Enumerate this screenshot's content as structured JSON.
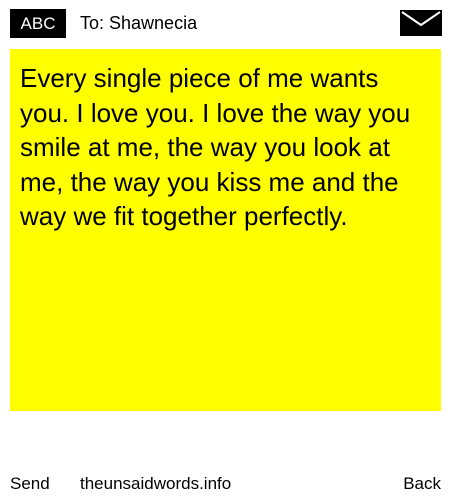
{
  "header": {
    "badge_label": "ABC",
    "to_label": "To:",
    "recipient_name": "Shawnecia",
    "envelope_icon": "envelope-icon"
  },
  "message": {
    "body": "Every single piece of me wants you. I love you. I love the way you smile at me, the way you look at me, the way you kiss me and the way we fit together perfectly.",
    "background_color": "#ffff00"
  },
  "footer": {
    "send_label": "Send",
    "site_label": "theunsaidwords.info",
    "back_label": "Back"
  }
}
